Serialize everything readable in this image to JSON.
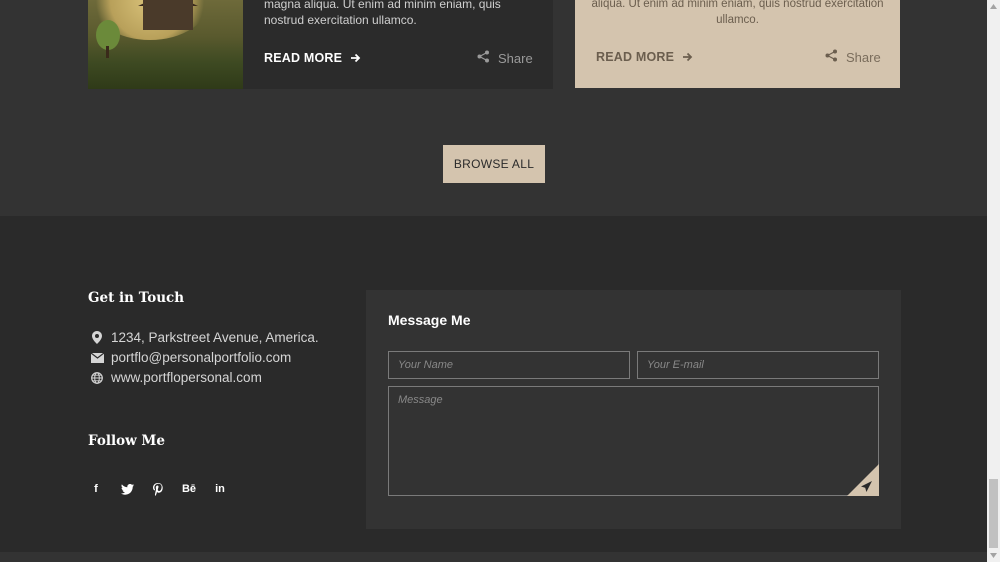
{
  "cards": {
    "dark": {
      "text": "magna aliqua. Ut enim ad minim eniam, quis nostrud exercitation ullamco.",
      "read_more": "READ MORE",
      "share": "Share"
    },
    "light": {
      "text": "aliqua. Ut enim ad minim eniam, quis nostrud exercitation ullamco.",
      "read_more": "READ MORE",
      "share": "Share"
    }
  },
  "browse_all": "BROWSE ALL",
  "footer": {
    "get_in_touch": "Get in Touch",
    "address": "1234, Parkstreet Avenue, America.",
    "email": "portflo@personalportfolio.com",
    "website": "www.portflopersonal.com",
    "follow_me": "Follow Me",
    "social": [
      {
        "icon": "facebook-icon",
        "glyph": "f"
      },
      {
        "icon": "twitter-icon",
        "glyph": "t"
      },
      {
        "icon": "pinterest-icon",
        "glyph": "p"
      },
      {
        "icon": "behance-icon",
        "glyph": "Bē"
      },
      {
        "icon": "linkedin-icon",
        "glyph": "in"
      }
    ]
  },
  "message_form": {
    "title": "Message Me",
    "name_placeholder": "Your Name",
    "email_placeholder": "Your E-mail",
    "message_placeholder": "Message"
  },
  "colors": {
    "accent": "#d4c4ae",
    "footer_bg": "#2a2a2a",
    "section_bg": "#333333"
  }
}
